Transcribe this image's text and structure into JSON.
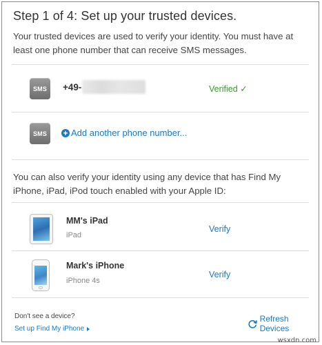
{
  "header": {
    "title": "Step 1 of 4: Set up your trusted devices.",
    "intro": "Your trusted devices are used to verify your identity. You must have at least one phone number that can receive SMS messages."
  },
  "phones": {
    "sms_label": "SMS",
    "number_prefix": "+49-",
    "verified_label": "Verified",
    "verified_check": "✓",
    "add_label": "Add another phone number...",
    "add_symbol": "+"
  },
  "find_my": {
    "text": "You can also verify your identity using any device that has Find My iPhone, iPad, iPod touch enabled with your Apple ID:"
  },
  "devices": [
    {
      "name": "MM's iPad",
      "model": "iPad",
      "action": "Verify",
      "icon": "ipad-icon"
    },
    {
      "name": "Mark's iPhone",
      "model": "iPhone 4s",
      "action": "Verify",
      "icon": "iphone-icon"
    }
  ],
  "footer": {
    "no_device": "Don't see a device?",
    "setup_link": "Set up Find My iPhone",
    "refresh_label": "Refresh Devices"
  },
  "watermark": "wsxdn.com",
  "colors": {
    "link": "#1a79c4",
    "verified": "#3a9a2c"
  }
}
